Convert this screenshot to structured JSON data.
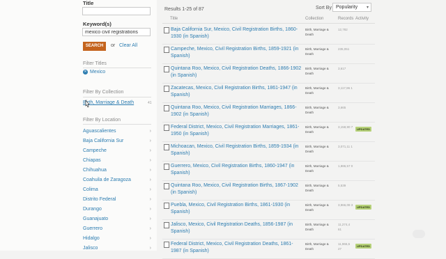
{
  "sidebar": {
    "title_label": "Title",
    "title_value": "",
    "keyword_label": "Keyword(s)",
    "keyword_value": "mexico civil registrations",
    "search_button": "SEARCH",
    "or_text": "or",
    "clear_all": "Clear All",
    "filter_titles_heading": "Filter Titles",
    "active_filter": "Mexico",
    "filter_collection_heading": "Filter By Collection",
    "collection_link": "Birth, Marriage & Death",
    "collection_count": "41",
    "filter_location_heading": "Filter By Location",
    "locations": [
      "Aguascalientes",
      "Baja California Sur",
      "Campeche",
      "Chiapas",
      "Chihuahua",
      "Coahuila de Zaragoza",
      "Colima",
      "Distrito Federal",
      "Durango",
      "Guanajuato",
      "Guerrero",
      "Hidalgo",
      "Jalisco"
    ]
  },
  "main": {
    "results_text": "Results 1-25 of 87",
    "sort_label": "Sort By",
    "sort_value": "Popularity",
    "columns": {
      "title": "Title",
      "collection": "Collection",
      "records": "Records",
      "activity": "Activity"
    },
    "rows": [
      {
        "title": "Baja California Sur, Mexico, Civil Registration Births, 1860-1930 (in Spanish)",
        "collection": "Birth, Marriage & Death",
        "records": "12,782",
        "badge": ""
      },
      {
        "title": "Campeche, Mexico, Civil Registration Births, 1859-1921 (in Spanish)",
        "collection": "Birth, Marriage & Death",
        "records": "235,051",
        "badge": ""
      },
      {
        "title": "Quintana Roo, Mexico, Civil Registration Deaths, 1866-1902 (in Spanish)",
        "collection": "Birth, Marriage & Death",
        "records": "3,617",
        "badge": ""
      },
      {
        "title": "Zacatecas, Mexico, Civil Registration Births, 1861-1947 (in Spanish)",
        "collection": "Birth, Marriage & Death",
        "records": "3,117,96 1",
        "badge": ""
      },
      {
        "title": "Quintana Roo, Mexico, Civil Registration Marriages, 1866-1902 (in Spanish)",
        "collection": "Birth, Marriage & Death",
        "records": "3,665",
        "badge": ""
      },
      {
        "title": "Federal District, Mexico, Civil Registration Marriages, 1861-1950 (in Spanish)",
        "collection": "Birth, Marriage & Death",
        "records": "3,158,90 7",
        "badge": "UPDATED"
      },
      {
        "title": "Michoacan, Mexico, Civil Registration Births, 1859-1934 (in Spanish)",
        "collection": "Birth, Marriage & Death",
        "records": "3,071,11 1",
        "badge": ""
      },
      {
        "title": "Guerrero, Mexico, Civil Registration Births, 1860-1947 (in Spanish)",
        "collection": "Birth, Marriage & Death",
        "records": "1,886,57 0",
        "badge": ""
      },
      {
        "title": "Quintana Roo, Mexico, Civil Registration Births, 1867-1902 (in Spanish)",
        "collection": "Birth, Marriage & Death",
        "records": "5,539",
        "badge": ""
      },
      {
        "title": "Puebla, Mexico, Civil Registration Births, 1861-1930 (in Spanish)",
        "collection": "Birth, Marriage & Death",
        "records": "3,966,08 3",
        "badge": "UPDATED"
      },
      {
        "title": "Jalisco, Mexico, Civil Registration Deaths, 1856-1987 (in Spanish)",
        "collection": "Birth, Marriage & Death",
        "records": "11,274,4 61",
        "badge": ""
      },
      {
        "title": "Federal District, Mexico, Civil Registration Deaths, 1861-1987 (in Spanish)",
        "collection": "Birth, Marriage & Death",
        "records": "11,966,5 27",
        "badge": "UPDATED"
      }
    ]
  }
}
